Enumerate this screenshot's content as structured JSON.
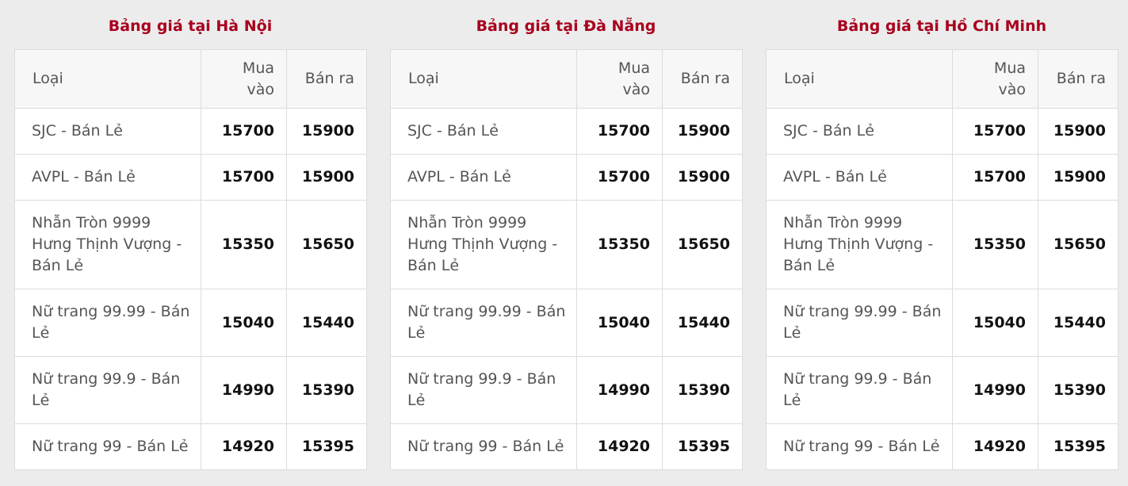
{
  "headers": {
    "type": "Loại",
    "buy": "Mua vào",
    "sell": "Bán ra"
  },
  "panels": [
    {
      "title": "Bảng giá tại Hà Nội",
      "rows": [
        {
          "type": "SJC - Bán Lẻ",
          "buy": "15700",
          "sell": "15900"
        },
        {
          "type": "AVPL - Bán Lẻ",
          "buy": "15700",
          "sell": "15900"
        },
        {
          "type": "Nhẫn Tròn 9999 Hưng Thịnh Vượng - Bán Lẻ",
          "buy": "15350",
          "sell": "15650"
        },
        {
          "type": "Nữ trang 99.99 - Bán Lẻ",
          "buy": "15040",
          "sell": "15440"
        },
        {
          "type": "Nữ trang 99.9 - Bán Lẻ",
          "buy": "14990",
          "sell": "15390"
        },
        {
          "type": "Nữ trang 99 - Bán Lẻ",
          "buy": "14920",
          "sell": "15395"
        }
      ]
    },
    {
      "title": "Bảng giá tại Đà Nẵng",
      "rows": [
        {
          "type": "SJC - Bán Lẻ",
          "buy": "15700",
          "sell": "15900"
        },
        {
          "type": "AVPL - Bán Lẻ",
          "buy": "15700",
          "sell": "15900"
        },
        {
          "type": "Nhẫn Tròn 9999 Hưng Thịnh Vượng - Bán Lẻ",
          "buy": "15350",
          "sell": "15650"
        },
        {
          "type": "Nữ trang 99.99 - Bán Lẻ",
          "buy": "15040",
          "sell": "15440"
        },
        {
          "type": "Nữ trang 99.9 - Bán Lẻ",
          "buy": "14990",
          "sell": "15390"
        },
        {
          "type": "Nữ trang 99 - Bán Lẻ",
          "buy": "14920",
          "sell": "15395"
        }
      ]
    },
    {
      "title": "Bảng giá tại Hồ Chí Minh",
      "rows": [
        {
          "type": "SJC - Bán Lẻ",
          "buy": "15700",
          "sell": "15900"
        },
        {
          "type": "AVPL - Bán Lẻ",
          "buy": "15700",
          "sell": "15900"
        },
        {
          "type": "Nhẫn Tròn 9999 Hưng Thịnh Vượng - Bán Lẻ",
          "buy": "15350",
          "sell": "15650"
        },
        {
          "type": "Nữ trang 99.99 - Bán Lẻ",
          "buy": "15040",
          "sell": "15440"
        },
        {
          "type": "Nữ trang 99.9 - Bán Lẻ",
          "buy": "14990",
          "sell": "15390"
        },
        {
          "type": "Nữ trang 99 - Bán Lẻ",
          "buy": "14920",
          "sell": "15395"
        }
      ]
    }
  ],
  "colors": {
    "title": "#a8001e",
    "background": "#ececec",
    "border": "#dcdcdc",
    "header_bg": "#f7f7f7"
  }
}
